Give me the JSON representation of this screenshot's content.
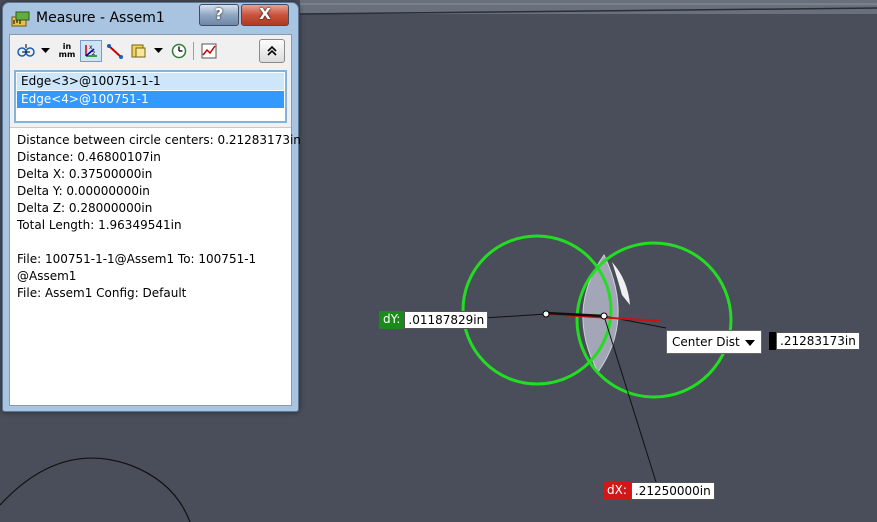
{
  "window": {
    "title": "Measure - Assem1",
    "help_label": "?",
    "close_label": "X"
  },
  "toolbar": {
    "units_top": "in",
    "units_bottom": "mm"
  },
  "selections": [
    {
      "label": "Edge<3>@100751-1-1",
      "active": false
    },
    {
      "label": "Edge<4>@100751-1",
      "active": true
    }
  ],
  "results": {
    "circle_centers": "Distance between circle centers:  0.21283173in",
    "distance": "Distance: 0.46800107in",
    "delta_x": "Delta X: 0.37500000in",
    "delta_y": "Delta Y: 0.00000000in",
    "delta_z": "Delta Z: 0.28000000in",
    "total_length": "Total Length: 1.96349541in",
    "file_line1": "File: 100751-1-1@Assem1 To: 100751-1",
    "file_line2": "@Assem1",
    "file_config": "File: Assem1 Config: Default"
  },
  "callouts": {
    "dy_label": "dY:",
    "dy_value": ".01187829in",
    "dx_label": "dX:",
    "dx_value": ".21250000in",
    "center_mode": "Center Dist",
    "center_value": ".21283173in"
  },
  "colors": {
    "viewport_bg": "#4a4e5a",
    "circle": "#22dd22",
    "dy_tag": "#1a8a1a",
    "dx_tag": "#d01818",
    "selection_active": "#3399ff"
  }
}
